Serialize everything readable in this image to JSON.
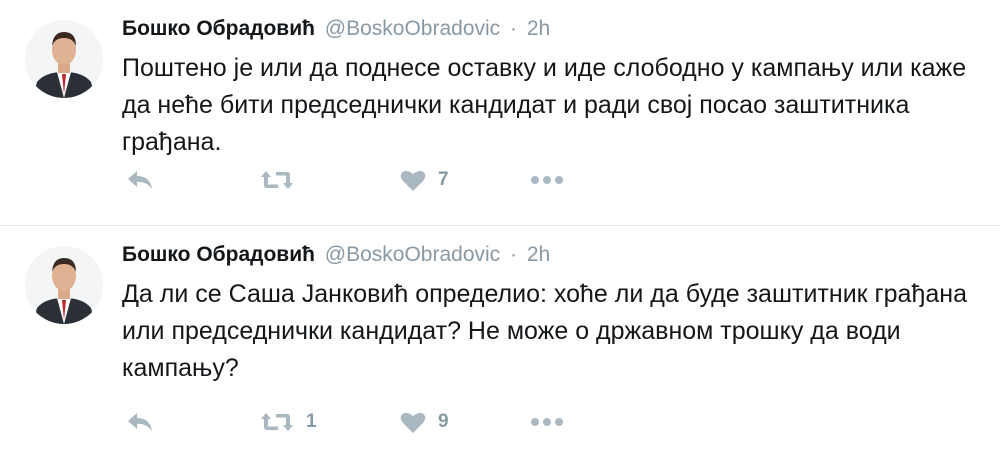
{
  "colors": {
    "text": "#14171a",
    "muted": "#8899a6",
    "icon": "#aab8c2",
    "divider": "#e1e8ed"
  },
  "icons": {
    "reply": "reply-icon",
    "retweet": "retweet-icon",
    "like": "heart-icon",
    "more": "more-dots-icon"
  },
  "tweets": [
    {
      "fullname": "Бошко Обрадовић",
      "username": "@BoskoObradovic",
      "separator": "·",
      "time": "2h",
      "text": "Поштено је или да поднесе оставку и иде слободно у кампању или каже да неће бити председнички кандидат и ради свој посао заштитника грађана.",
      "retweet_count": "",
      "like_count": "7"
    },
    {
      "fullname": "Бошко Обрадовић",
      "username": "@BoskoObradovic",
      "separator": "·",
      "time": "2h",
      "text": "Да ли се Саша Јанковић определио: хоће ли да буде заштитник грађана или председнички кандидат? Не може о државном трошку да води кампању?",
      "retweet_count": "1",
      "like_count": "9"
    }
  ]
}
